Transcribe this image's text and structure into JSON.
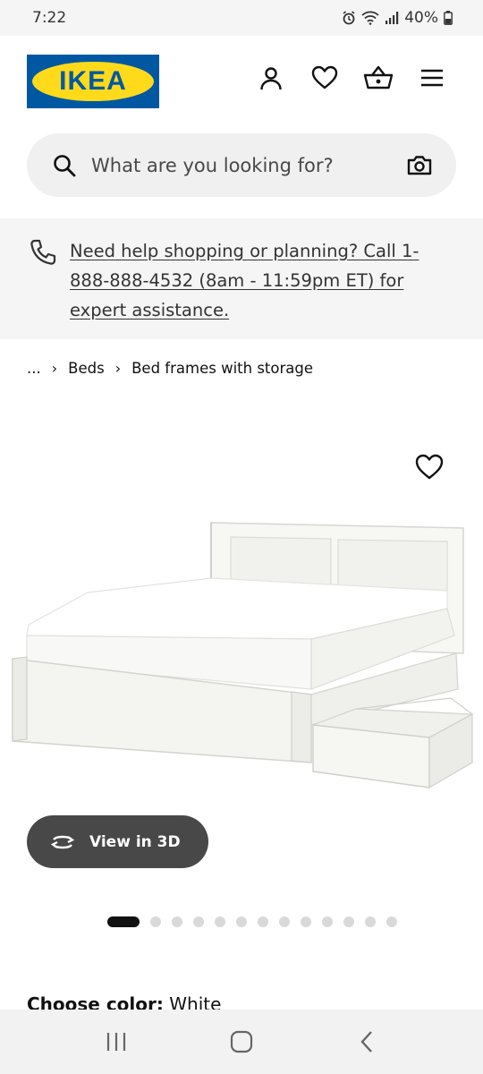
{
  "status_bar": {
    "time": "7:22",
    "battery": "40%",
    "icons": [
      "alarm-icon",
      "wifi-icon",
      "signal-icon",
      "battery-icon"
    ]
  },
  "header": {
    "logo_text": "IKEA",
    "logo_reg": "®",
    "icons": [
      "account-icon",
      "heart-icon",
      "basket-icon",
      "menu-icon"
    ],
    "colors": {
      "logo_blue": "#0058a3",
      "logo_yellow": "#ffda1a"
    }
  },
  "search": {
    "placeholder": "What are you looking for?",
    "icons": [
      "search-icon",
      "camera-icon"
    ]
  },
  "help_banner": {
    "text": "Need help shopping or planning? Call 1-888-888-4532 (8am - 11:59pm ET) for expert assistance.",
    "icon": "phone-icon"
  },
  "breadcrumb": {
    "items": [
      "...",
      "Beds",
      "Bed frames with storage"
    ]
  },
  "product": {
    "view3d_label": "View in 3D",
    "image_count": 13,
    "active_image": 1
  },
  "choose_color": {
    "label": "Choose color:",
    "value": "White"
  },
  "nav_bar": {
    "icons": [
      "recents-icon",
      "home-icon",
      "back-icon"
    ]
  }
}
